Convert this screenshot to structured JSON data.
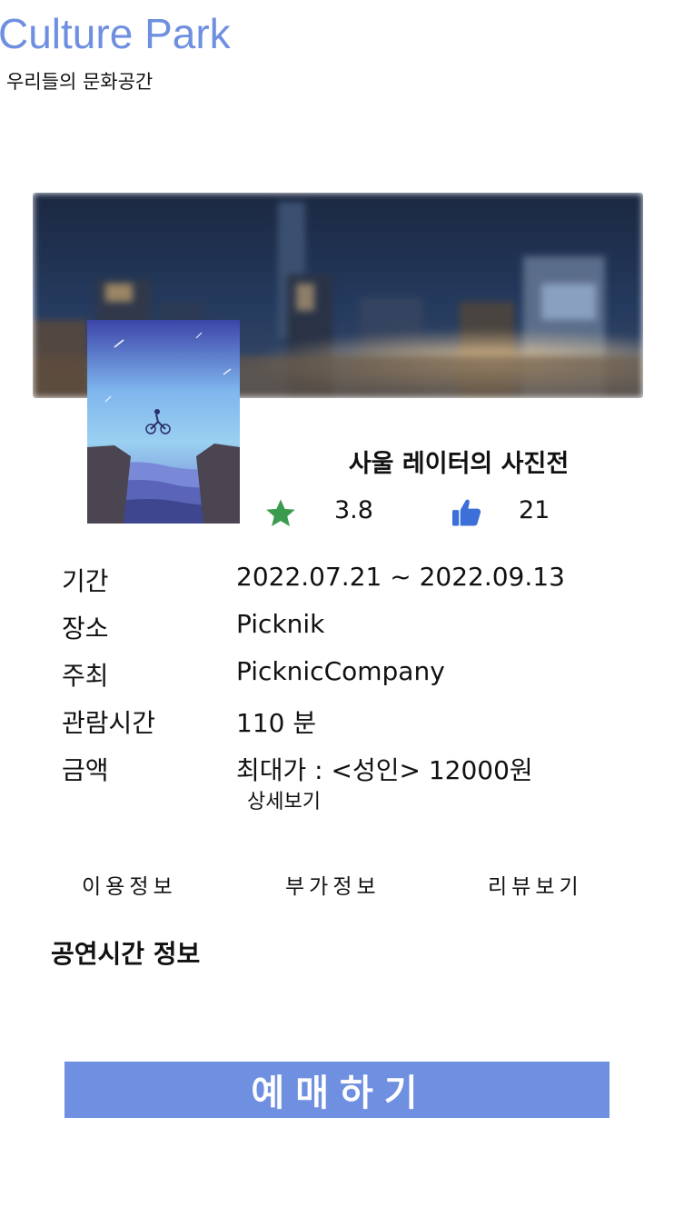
{
  "header": {
    "brand": "Culture Park",
    "tagline": "우리들의 문화공간"
  },
  "exhibition": {
    "title": "사울 레이터의 사진전",
    "rating": "3.8",
    "likes": "21"
  },
  "info": [
    {
      "label": "기간",
      "value": "2022.07.21 ~ 2022.09.13"
    },
    {
      "label": "장소",
      "value": "Picknik"
    },
    {
      "label": "주최",
      "value": "PicknicCompany"
    },
    {
      "label": "관람시간",
      "value": "110 분"
    },
    {
      "label": "금액",
      "value": "최대가 : <성인> 12000원"
    }
  ],
  "more_link": "상세보기",
  "tabs": [
    "이용정보",
    "부가정보",
    "리뷰보기"
  ],
  "section_title": "공연시간 정보",
  "reserve_label": "예매하기",
  "icons": {
    "rating": "star-icon",
    "likes": "thumbs-up-icon"
  },
  "colors": {
    "brand": "#6f8fe0",
    "star": "#3a9a4e",
    "thumb": "#3d6fd8",
    "button": "#6f8fe0"
  }
}
